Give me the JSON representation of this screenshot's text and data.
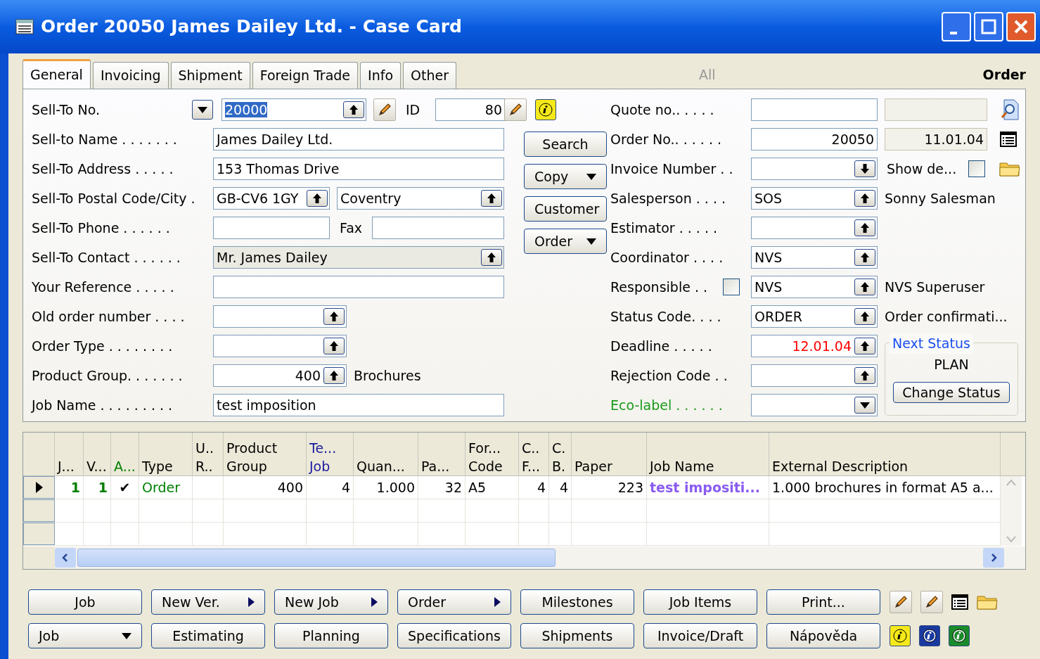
{
  "window": {
    "title": "Order 20050 James Dailey Ltd. - Case Card"
  },
  "tabs": [
    {
      "label": "General",
      "selected": true
    },
    {
      "label": "Invoicing",
      "selected": false
    },
    {
      "label": "Shipment",
      "selected": false
    },
    {
      "label": "Foreign Trade",
      "selected": false
    },
    {
      "label": "Info",
      "selected": false
    },
    {
      "label": "Other",
      "selected": false
    }
  ],
  "header": {
    "filter": "All",
    "page": "Order"
  },
  "general": {
    "sell_to_no": {
      "label": "Sell-To No.",
      "value": "20000",
      "highlighted": true,
      "id_label": "ID",
      "id_value": "80"
    },
    "sell_to_name": {
      "label": "Sell-to Name . . . . . . .",
      "value": "James Dailey Ltd."
    },
    "sell_to_address": {
      "label": "Sell-To Address . . . . .",
      "value": "153 Thomas Drive"
    },
    "postal_city": {
      "label": "Sell-To Postal Code/City .",
      "postal": "GB-CV6 1GY",
      "city": "Coventry"
    },
    "phone": {
      "label": "Sell-To Phone . . . . . .",
      "fax_label": "Fax"
    },
    "contact": {
      "label": "Sell-To Contact . . . . . .",
      "value": "Mr. James Dailey"
    },
    "your_reference": {
      "label": "Your Reference . . . . ."
    },
    "old_order_number": {
      "label": "Old order number . . . ."
    },
    "order_type": {
      "label": "Order Type . . . . . . . ."
    },
    "product_group": {
      "label": "Product Group. . . . . . .",
      "value": "400",
      "description": "Brochures"
    },
    "job_name": {
      "label": "Job Name . . . . . . . . .",
      "value": "test imposition"
    }
  },
  "side_buttons": [
    {
      "label": "Search",
      "kind": "plain"
    },
    {
      "label": "Copy",
      "kind": "dropdown"
    },
    {
      "label": "Customer",
      "kind": "plain"
    },
    {
      "label": "Order",
      "kind": "dropdown"
    }
  ],
  "right": {
    "quote_no": {
      "label": "Quote no.. . . . ."
    },
    "order_no": {
      "label": "Order No.. . . . . .",
      "value": "20050",
      "date": "11.01.04"
    },
    "invoice_number": {
      "label": "Invoice Number . .",
      "show_label": "Show de...",
      "show_checked": false
    },
    "salesperson": {
      "label": "Salesperson . . . .",
      "value": "SOS",
      "name": "Sonny Salesman"
    },
    "estimator": {
      "label": "Estimator . . . . ."
    },
    "coordinator": {
      "label": "Coordinator . . . .",
      "value": "NVS"
    },
    "responsible": {
      "label": "Responsible . .",
      "checked": false,
      "value": "NVS",
      "name": "NVS Superuser"
    },
    "status_code": {
      "label": "Status Code. . . .",
      "value": "ORDER",
      "description": "Order confirmati..."
    },
    "deadline": {
      "label": "Deadline . . . . .",
      "value": "12.01.04",
      "overdue": true
    },
    "rejection_code": {
      "label": "Rejection Code . ."
    },
    "eco_label": {
      "label": "Eco-label . . . . . ."
    },
    "next_status": {
      "title": "Next Status",
      "value": "PLAN",
      "button": "Change Status"
    }
  },
  "table": {
    "columns": [
      {
        "label": [
          "J..."
        ],
        "kind": "flag"
      },
      {
        "label": [
          "V..."
        ],
        "kind": "flag"
      },
      {
        "label": [
          "A..."
        ],
        "kind": "check"
      },
      {
        "label": [
          "Type"
        ],
        "kind": "status"
      },
      {
        "label": [
          "U..",
          "R.."
        ],
        "kind": "text"
      },
      {
        "label": [
          "Product",
          "Group"
        ],
        "kind": "number"
      },
      {
        "label": [
          "Te...",
          "Job"
        ],
        "kind": "ref"
      },
      {
        "label": [
          "Quan..."
        ],
        "kind": "number"
      },
      {
        "label": [
          "Pa..."
        ],
        "kind": "number"
      },
      {
        "label": [
          "For...",
          "Code"
        ],
        "kind": "text"
      },
      {
        "label": [
          "C..",
          "F..."
        ],
        "kind": "number"
      },
      {
        "label": [
          "C.",
          "B."
        ],
        "kind": "number"
      },
      {
        "label": [
          "Paper"
        ],
        "kind": "number"
      },
      {
        "label": [
          "Job Name"
        ],
        "kind": "link"
      },
      {
        "label": [
          "External Description"
        ],
        "kind": "text"
      }
    ],
    "rows": [
      {
        "current": true,
        "cells": [
          "1",
          "1",
          "✔",
          "Order",
          "",
          "400",
          "4",
          "1.000",
          "32",
          "A5",
          "4",
          "4",
          "223",
          "test impositi...",
          "1.000 brochures in format A5 a..."
        ]
      },
      {
        "current": false
      },
      {
        "current": false
      }
    ]
  },
  "bottom_buttons": [
    [
      {
        "label": "Job",
        "kind": "plain"
      },
      {
        "label": "New Ver.",
        "kind": "menu"
      },
      {
        "label": "New Job",
        "kind": "menu"
      },
      {
        "label": "Order",
        "kind": "menu"
      },
      {
        "label": "Milestones",
        "kind": "plain"
      },
      {
        "label": "Job Items",
        "kind": "plain"
      },
      {
        "label": "Print...",
        "kind": "plain"
      }
    ],
    [
      {
        "label": "Job",
        "kind": "dropdown"
      },
      {
        "label": "Estimating",
        "kind": "plain"
      },
      {
        "label": "Planning",
        "kind": "plain"
      },
      {
        "label": "Specifications",
        "kind": "plain"
      },
      {
        "label": "Shipments",
        "kind": "plain"
      },
      {
        "label": "Invoice/Draft",
        "kind": "plain"
      },
      {
        "label": "Nápověda",
        "kind": "plain"
      }
    ]
  ]
}
